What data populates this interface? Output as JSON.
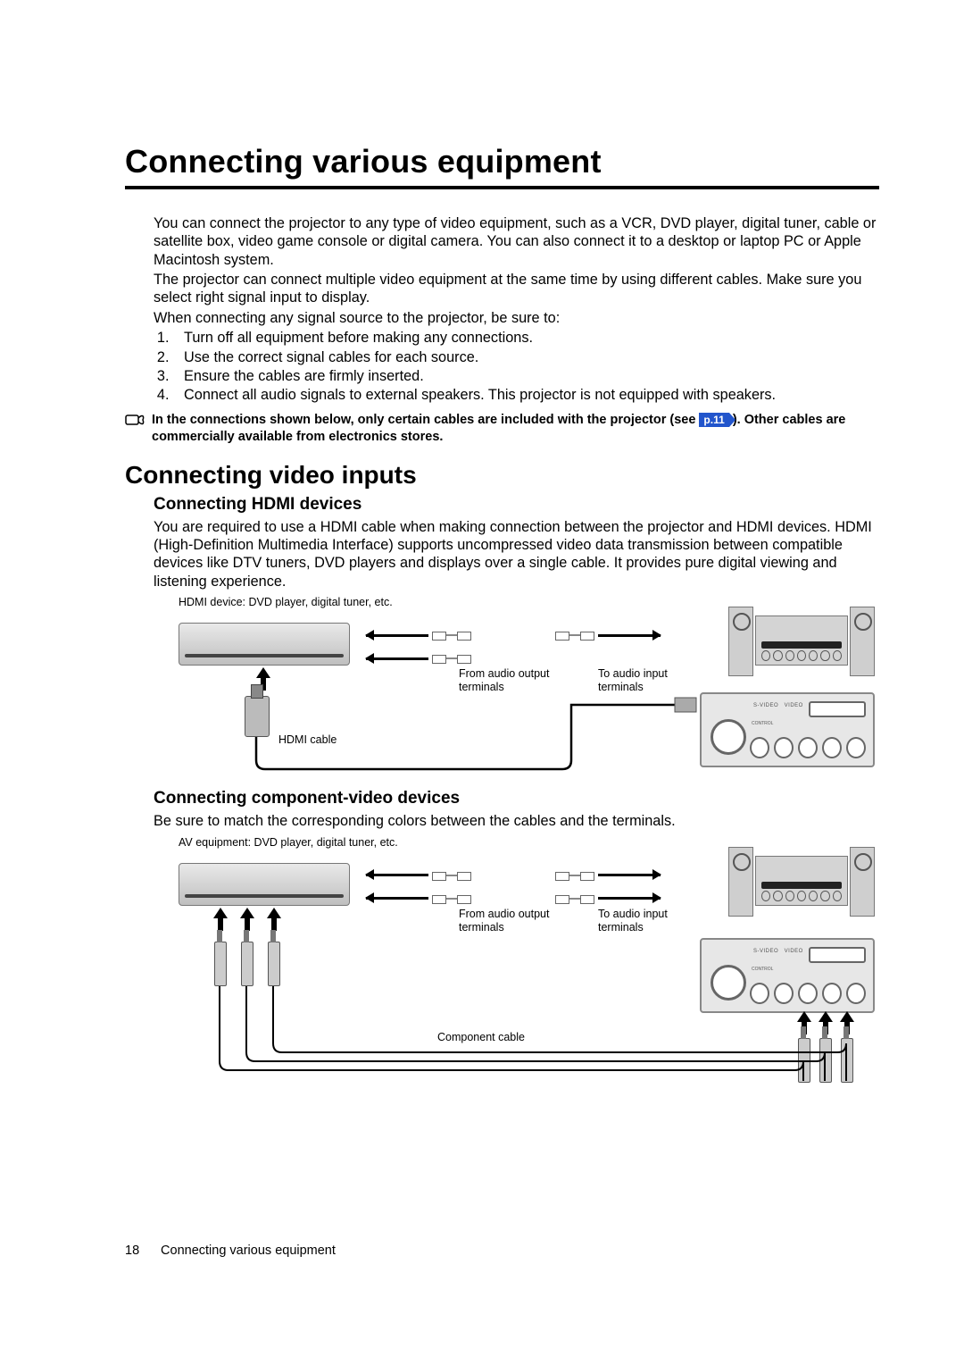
{
  "title": "Connecting various equipment",
  "intro_p1": "You can connect the projector to any type of video equipment, such as a VCR, DVD player, digital tuner, cable or satellite box, video game console or digital camera. You can also connect it to a desktop or laptop PC or Apple Macintosh system.",
  "intro_p2": "The projector can connect multiple video equipment at the same time by using different cables. Make sure you select right signal input to display.",
  "intro_p3": "When connecting any signal source to the projector, be sure to:",
  "steps": [
    "Turn off all equipment before making any connections.",
    "Use the correct signal cables for each source.",
    "Ensure the cables are firmly inserted.",
    "Connect all audio signals to external speakers. This projector is not equipped with speakers."
  ],
  "note_pre": "In the connections shown below, only certain cables are included with the projector (see ",
  "note_ref": "p.11",
  "note_post": " ). Other cables are commercially available from electronics stores.",
  "h2": "Connecting video inputs",
  "h3a": "Connecting HDMI devices",
  "hdmi_para": "You are required to use a HDMI cable when making connection between the projector and HDMI devices. HDMI (High-Definition Multimedia Interface) supports uncompressed video data transmission between compatible devices like DTV tuners, DVD players and displays over a single cable. It provides pure digital viewing and listening experience.",
  "hdmi_caption": "HDMI device: DVD player, digital tuner, etc.",
  "label_from": "From audio output terminals",
  "label_to": "To audio input terminals",
  "label_hdmi_cable": "HDMI cable",
  "h3b": "Connecting component-video devices",
  "comp_para": "Be sure to match the corresponding colors between the cables and the terminals.",
  "comp_caption": "AV equipment: DVD player, digital tuner, etc.",
  "label_component_cable": "Component cable",
  "footer_page": "18",
  "footer_text": "Connecting various equipment"
}
